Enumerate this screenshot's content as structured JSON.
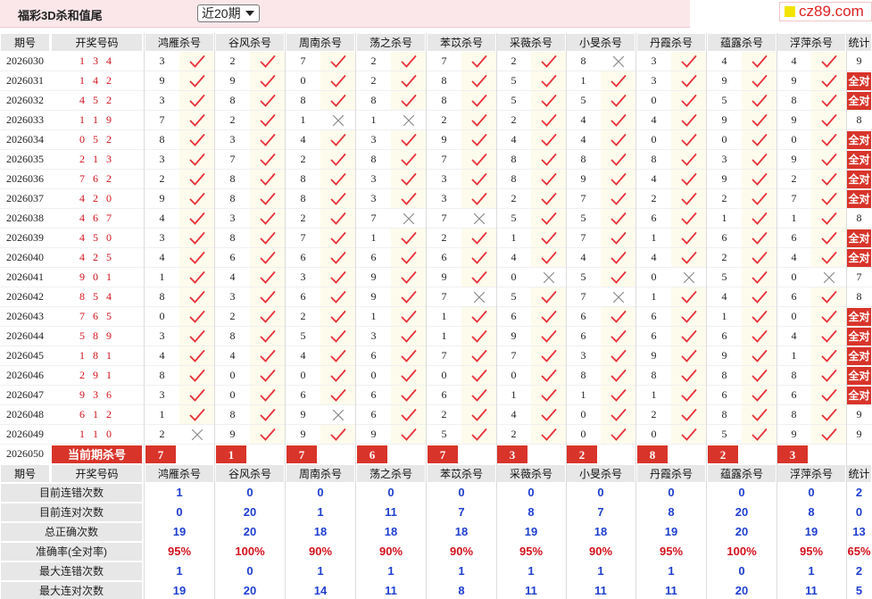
{
  "page": {
    "title": "福彩3D杀和值尾",
    "period_select": "近20期",
    "site_logo": "cz89.com"
  },
  "columns": {
    "period": "期号",
    "draw": "开奖号码",
    "experts": [
      "鸿雁杀号",
      "谷风杀号",
      "周南杀号",
      "荡之杀号",
      "苯苡杀号",
      "采薇杀号",
      "小旻杀号",
      "丹霞杀号",
      "蕴露杀号",
      "浮萍杀号"
    ],
    "stats": "统计"
  },
  "rows": [
    {
      "period": "2026030",
      "draw": "1 3 4",
      "vals": [
        3,
        2,
        7,
        2,
        7,
        2,
        8,
        3,
        4,
        4
      ],
      "res": [
        1,
        1,
        1,
        1,
        1,
        1,
        0,
        1,
        1,
        1
      ],
      "stat": "9"
    },
    {
      "period": "2026031",
      "draw": "1 4 2",
      "vals": [
        9,
        9,
        0,
        2,
        8,
        5,
        1,
        3,
        9,
        9
      ],
      "res": [
        1,
        1,
        1,
        1,
        1,
        1,
        1,
        1,
        1,
        1
      ],
      "stat": "全对"
    },
    {
      "period": "2026032",
      "draw": "4 5 2",
      "vals": [
        3,
        8,
        8,
        8,
        8,
        5,
        5,
        0,
        5,
        8
      ],
      "res": [
        1,
        1,
        1,
        1,
        1,
        1,
        1,
        1,
        1,
        1
      ],
      "stat": "全对"
    },
    {
      "period": "2026033",
      "draw": "1 1 9",
      "vals": [
        7,
        2,
        1,
        1,
        2,
        2,
        4,
        4,
        9,
        9
      ],
      "res": [
        1,
        1,
        0,
        0,
        1,
        1,
        1,
        1,
        1,
        1
      ],
      "stat": "8"
    },
    {
      "period": "2026034",
      "draw": "0 5 2",
      "vals": [
        8,
        3,
        4,
        3,
        9,
        4,
        4,
        0,
        0,
        0
      ],
      "res": [
        1,
        1,
        1,
        1,
        1,
        1,
        1,
        1,
        1,
        1
      ],
      "stat": "全对"
    },
    {
      "period": "2026035",
      "draw": "2 1 3",
      "vals": [
        3,
        7,
        2,
        8,
        7,
        8,
        8,
        8,
        3,
        9
      ],
      "res": [
        1,
        1,
        1,
        1,
        1,
        1,
        1,
        1,
        1,
        1
      ],
      "stat": "全对"
    },
    {
      "period": "2026036",
      "draw": "7 6 2",
      "vals": [
        2,
        8,
        8,
        3,
        3,
        8,
        9,
        4,
        9,
        2
      ],
      "res": [
        1,
        1,
        1,
        1,
        1,
        1,
        1,
        1,
        1,
        1
      ],
      "stat": "全对"
    },
    {
      "period": "2026037",
      "draw": "4 2 0",
      "vals": [
        9,
        8,
        8,
        3,
        3,
        2,
        7,
        2,
        2,
        7
      ],
      "res": [
        1,
        1,
        1,
        1,
        1,
        1,
        1,
        1,
        1,
        1
      ],
      "stat": "全对"
    },
    {
      "period": "2026038",
      "draw": "4 6 7",
      "vals": [
        4,
        3,
        2,
        7,
        7,
        5,
        5,
        6,
        1,
        1
      ],
      "res": [
        1,
        1,
        1,
        0,
        0,
        1,
        1,
        1,
        1,
        1
      ],
      "stat": "8"
    },
    {
      "period": "2026039",
      "draw": "4 5 0",
      "vals": [
        3,
        8,
        7,
        1,
        2,
        1,
        7,
        1,
        6,
        6
      ],
      "res": [
        1,
        1,
        1,
        1,
        1,
        1,
        1,
        1,
        1,
        1
      ],
      "stat": "全对"
    },
    {
      "period": "2026040",
      "draw": "4 2 5",
      "vals": [
        4,
        6,
        6,
        6,
        6,
        4,
        4,
        4,
        2,
        4
      ],
      "res": [
        1,
        1,
        1,
        1,
        1,
        1,
        1,
        1,
        1,
        1
      ],
      "stat": "全对"
    },
    {
      "period": "2026041",
      "draw": "9 0 1",
      "vals": [
        1,
        4,
        3,
        9,
        9,
        0,
        5,
        0,
        5,
        0
      ],
      "res": [
        1,
        1,
        1,
        1,
        1,
        0,
        1,
        0,
        1,
        0
      ],
      "stat": "7"
    },
    {
      "period": "2026042",
      "draw": "8 5 4",
      "vals": [
        8,
        3,
        6,
        9,
        7,
        5,
        7,
        1,
        4,
        6
      ],
      "res": [
        1,
        1,
        1,
        1,
        0,
        1,
        0,
        1,
        1,
        1
      ],
      "stat": "8"
    },
    {
      "period": "2026043",
      "draw": "7 6 5",
      "vals": [
        0,
        2,
        2,
        1,
        1,
        6,
        6,
        6,
        1,
        0
      ],
      "res": [
        1,
        1,
        1,
        1,
        1,
        1,
        1,
        1,
        1,
        1
      ],
      "stat": "全对"
    },
    {
      "period": "2026044",
      "draw": "5 8 9",
      "vals": [
        3,
        8,
        5,
        3,
        1,
        9,
        6,
        6,
        6,
        4
      ],
      "res": [
        1,
        1,
        1,
        1,
        1,
        1,
        1,
        1,
        1,
        1
      ],
      "stat": "全对"
    },
    {
      "period": "2026045",
      "draw": "1 8 1",
      "vals": [
        4,
        4,
        4,
        6,
        7,
        7,
        3,
        9,
        9,
        1
      ],
      "res": [
        1,
        1,
        1,
        1,
        1,
        1,
        1,
        1,
        1,
        1
      ],
      "stat": "全对"
    },
    {
      "period": "2026046",
      "draw": "2 9 1",
      "vals": [
        8,
        0,
        0,
        0,
        0,
        0,
        8,
        8,
        8,
        8
      ],
      "res": [
        1,
        1,
        1,
        1,
        1,
        1,
        1,
        1,
        1,
        1
      ],
      "stat": "全对"
    },
    {
      "period": "2026047",
      "draw": "9 3 6",
      "vals": [
        3,
        0,
        6,
        6,
        6,
        1,
        1,
        1,
        6,
        6
      ],
      "res": [
        1,
        1,
        1,
        1,
        1,
        1,
        1,
        1,
        1,
        1
      ],
      "stat": "全对"
    },
    {
      "period": "2026048",
      "draw": "6 1 2",
      "vals": [
        1,
        8,
        9,
        6,
        2,
        4,
        0,
        2,
        8,
        8
      ],
      "res": [
        1,
        1,
        0,
        1,
        1,
        1,
        1,
        1,
        1,
        1
      ],
      "stat": "9"
    },
    {
      "period": "2026049",
      "draw": "1 1 0",
      "vals": [
        2,
        9,
        9,
        9,
        5,
        2,
        0,
        0,
        5,
        9
      ],
      "res": [
        0,
        1,
        1,
        1,
        1,
        1,
        1,
        1,
        1,
        1
      ],
      "stat": "9"
    }
  ],
  "current": {
    "period": "2026050",
    "label": "当前期杀号",
    "vals": [
      "7",
      "1",
      "7",
      "6",
      "7",
      "3",
      "2",
      "8",
      "2",
      "3"
    ]
  },
  "stats_rows": [
    {
      "label": "目前连错次数",
      "vals": [
        "1",
        "0",
        "0",
        "0",
        "0",
        "0",
        "0",
        "0",
        "0",
        "0"
      ],
      "total": "2",
      "kind": "blue"
    },
    {
      "label": "目前连对次数",
      "vals": [
        "0",
        "20",
        "1",
        "11",
        "7",
        "8",
        "7",
        "8",
        "20",
        "8"
      ],
      "total": "0",
      "kind": "blue"
    },
    {
      "label": "总正确次数",
      "vals": [
        "19",
        "20",
        "18",
        "18",
        "18",
        "19",
        "18",
        "19",
        "20",
        "19"
      ],
      "total": "13",
      "kind": "blue"
    },
    {
      "label": "准确率(全对率)",
      "vals": [
        "95%",
        "100%",
        "90%",
        "90%",
        "90%",
        "95%",
        "90%",
        "95%",
        "100%",
        "95%"
      ],
      "total": "65%",
      "kind": "red"
    },
    {
      "label": "最大连错次数",
      "vals": [
        "1",
        "0",
        "1",
        "1",
        "1",
        "1",
        "1",
        "1",
        "0",
        "1"
      ],
      "total": "2",
      "kind": "blue"
    },
    {
      "label": "最大连对次数",
      "vals": [
        "19",
        "20",
        "14",
        "11",
        "8",
        "11",
        "11",
        "11",
        "20",
        "11"
      ],
      "total": "5",
      "kind": "blue"
    }
  ],
  "colors": {
    "accent_red": "#d8342a",
    "draw_red": "#d2121c",
    "check_red": "#e8323a",
    "cross_gray": "#8a8a8a",
    "stat_blue": "#1f3fcf",
    "stat_red": "#d2121c"
  },
  "icons": {
    "correct": "check-mark-icon",
    "wrong": "cross-icon",
    "dropdown": "chevron-down-icon"
  }
}
